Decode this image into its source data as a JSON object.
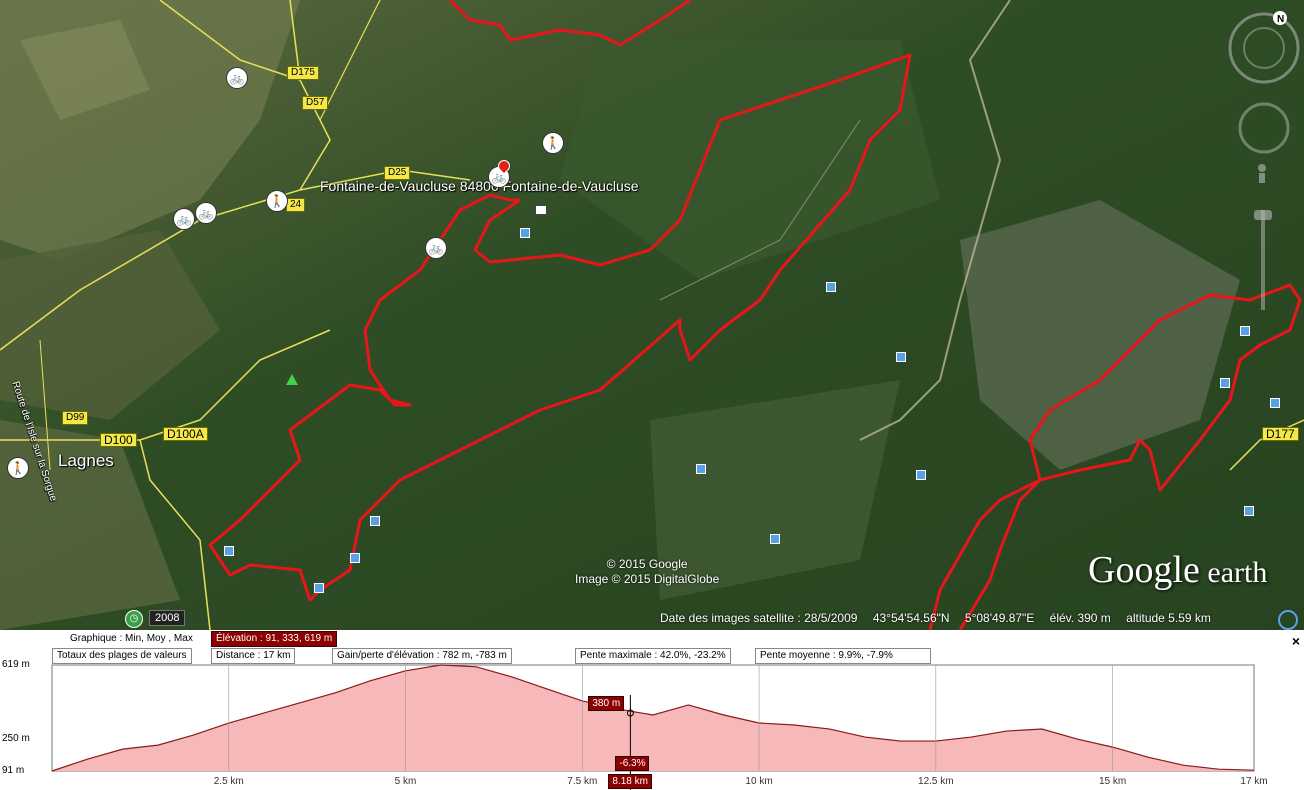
{
  "map": {
    "place_labels": {
      "fontaine": "Fontaine-de-Vaucluse 84800 Fontaine-de-Vaucluse",
      "lagnes": "Lagnes",
      "route": "Route de l'Isle sur la Sorgue"
    },
    "roads": {
      "d175": "D175",
      "d57": "D57",
      "d25": "D25",
      "d24": "24",
      "d99": "D99",
      "d100": "D100",
      "d100a": "D100A",
      "d177": "D177"
    },
    "credits": {
      "line1": "© 2015 Google",
      "line2": "Image © 2015 DigitalGlobe"
    },
    "logo": {
      "main": "Google",
      "suffix": " earth"
    },
    "year": "2008",
    "status": {
      "date": "Date des images satellite : 28/5/2009",
      "lat": "43°54'54.56\"N",
      "lon": "5°08'49.87\"E",
      "elev": "élév.   390 m",
      "alt": "altitude   5.59 km"
    },
    "compass_letter": "N",
    "icons": {
      "hiker": "hiker-icon",
      "cyclist": "cyclist-icon",
      "pin": "location-pin-icon",
      "photo": "photo-icon"
    }
  },
  "profile": {
    "row1": {
      "label": "Graphique : Min, Moy , Max",
      "elevation": "Élévation : 91, 333, 619 m"
    },
    "row2": {
      "label": "Totaux des plages de valeurs",
      "distance": "Distance : 17 km",
      "gain": "Gain/perte d'élévation : 782 m, -783 m",
      "max_slope": "Pente maximale : 42.0%, -23.2%",
      "avg_slope": "Pente moyenne : 9.9%, -7.9%"
    },
    "close": "×",
    "cursor": {
      "elevation_label": "380 m",
      "slope_label": "-6.3%",
      "distance_label": "8.18 km",
      "distance_km": 8.18
    }
  },
  "chart_data": {
    "type": "area",
    "x": [
      0,
      0.5,
      1,
      1.5,
      2,
      2.5,
      3,
      3.5,
      4,
      4.5,
      5,
      5.5,
      6,
      6.5,
      7,
      7.5,
      8,
      8.5,
      9,
      9.5,
      10,
      10.5,
      11,
      11.5,
      12,
      12.5,
      13,
      13.5,
      14,
      14.5,
      15,
      15.5,
      16,
      16.5,
      17
    ],
    "y": [
      91,
      150,
      200,
      220,
      270,
      330,
      380,
      430,
      480,
      540,
      590,
      619,
      610,
      560,
      500,
      440,
      400,
      370,
      420,
      370,
      330,
      320,
      300,
      260,
      240,
      240,
      260,
      290,
      300,
      250,
      210,
      160,
      120,
      100,
      95
    ],
    "xlabel": "",
    "ylabel": "",
    "x_ticks": [
      {
        "value": 2.5,
        "label": "2.5 km"
      },
      {
        "value": 5,
        "label": "5 km"
      },
      {
        "value": 7.5,
        "label": "7.5 km"
      },
      {
        "value": 10,
        "label": "10 km"
      },
      {
        "value": 12.5,
        "label": "12.5 km"
      },
      {
        "value": 15,
        "label": "15 km"
      },
      {
        "value": 17,
        "label": "17 km"
      }
    ],
    "y_ticks": [
      {
        "value": 91,
        "label": "91 m"
      },
      {
        "value": 250,
        "label": "250 m"
      },
      {
        "value": 619,
        "label": "619 m"
      }
    ],
    "xlim": [
      0,
      17
    ],
    "ylim": [
      91,
      619
    ],
    "fill_color": "#f6b8b8",
    "line_color": "#8b1a1a"
  },
  "colors": {
    "route": "#e8151b",
    "highlight": "#8b0000"
  }
}
